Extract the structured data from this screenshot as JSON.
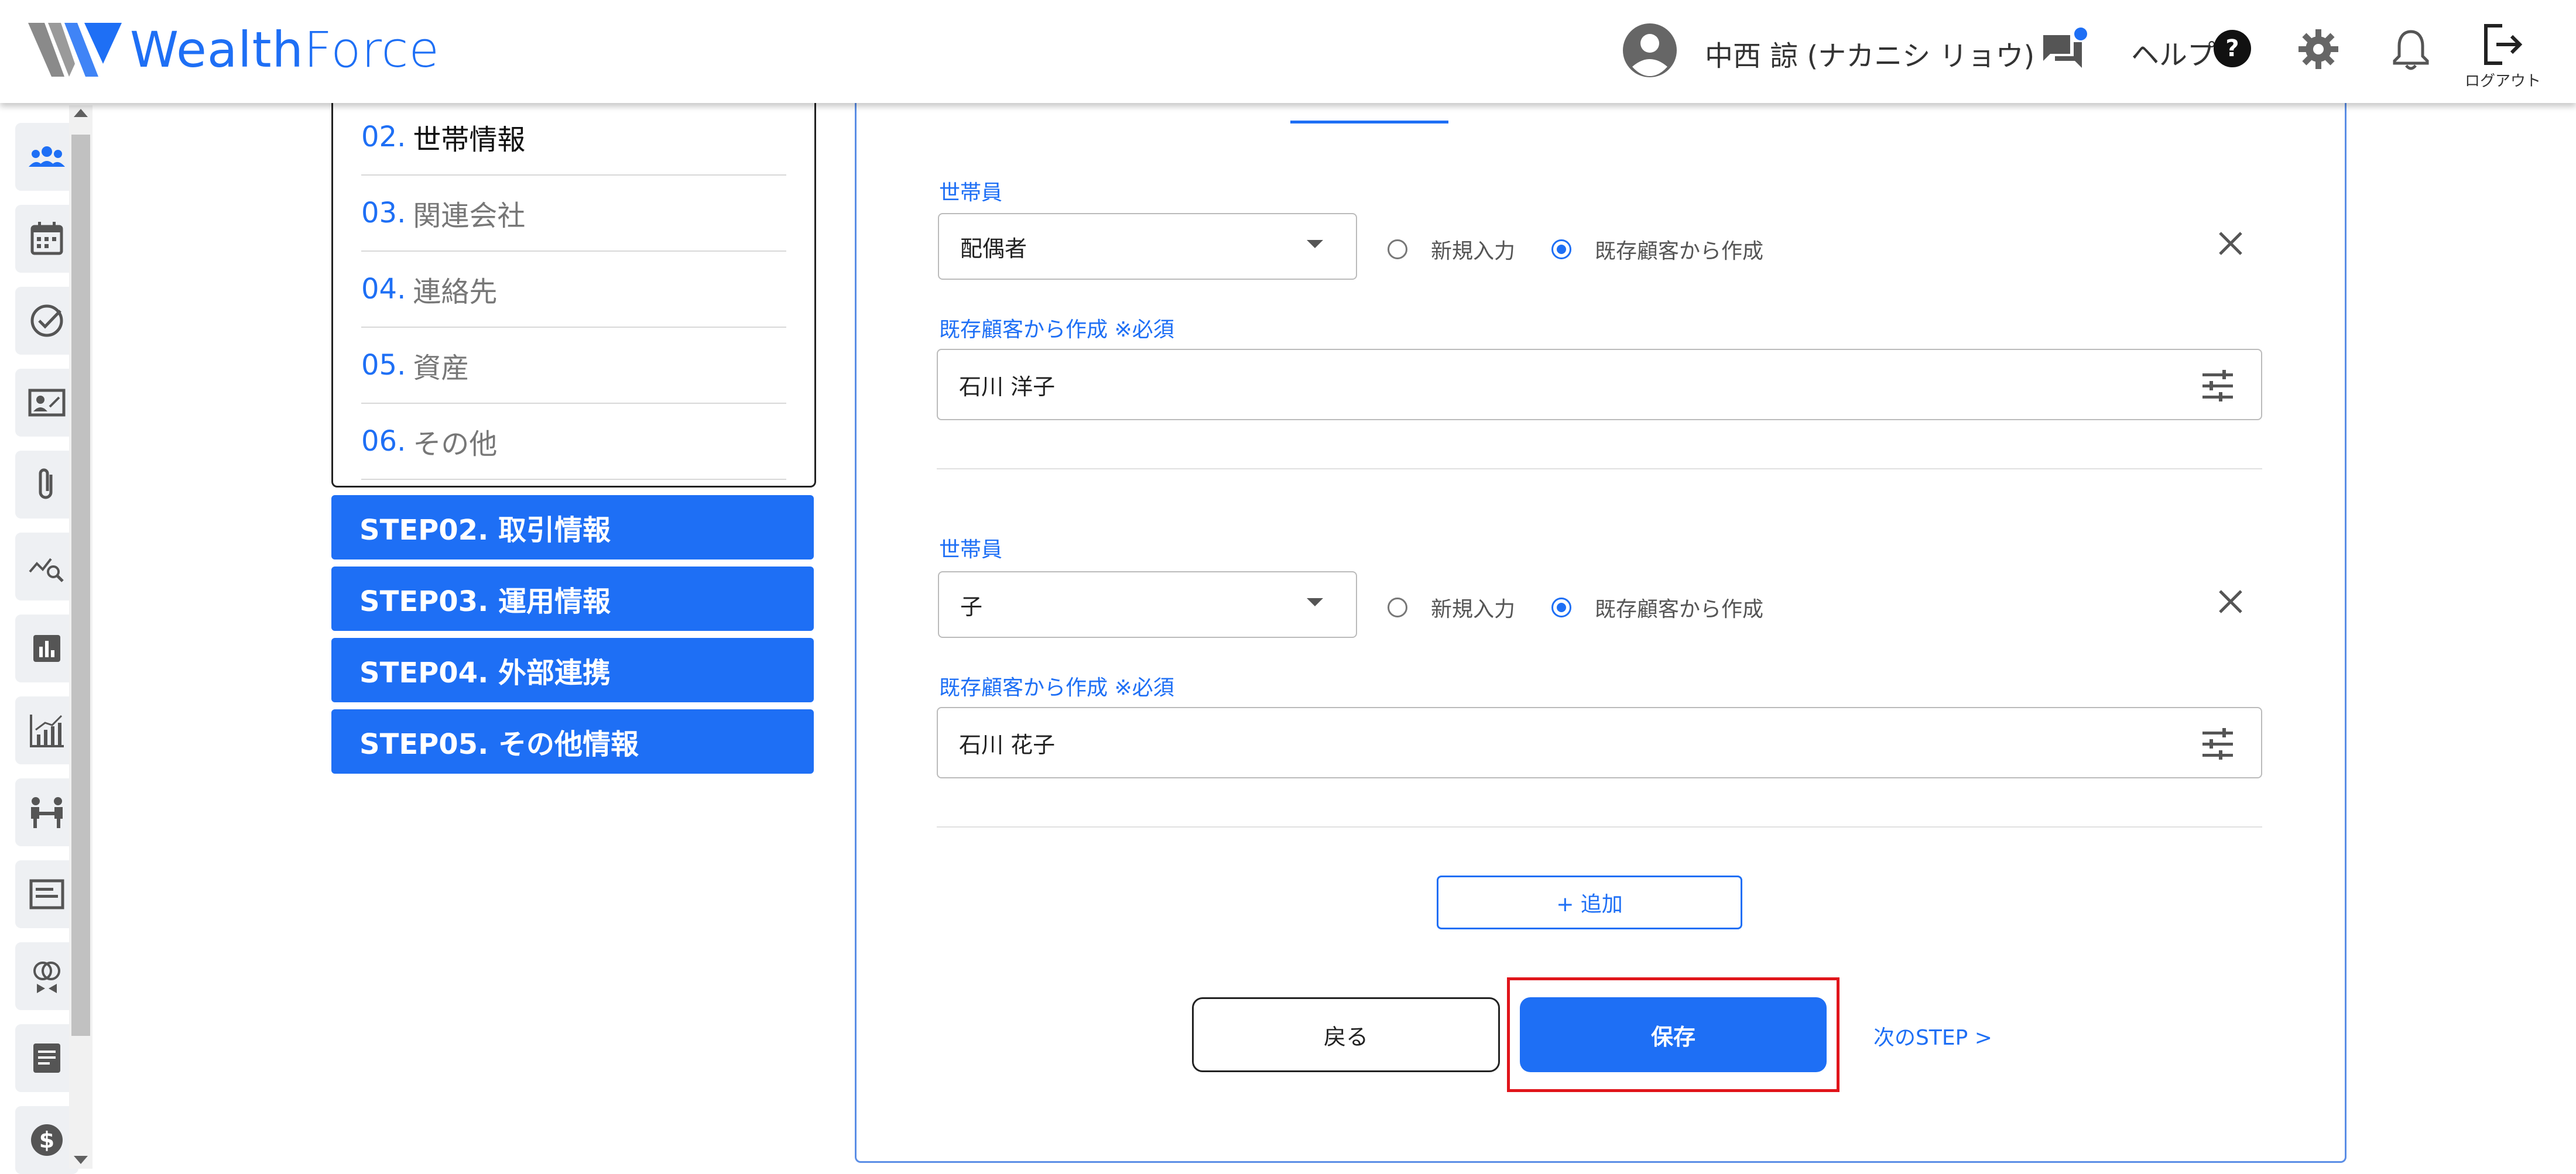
{
  "header": {
    "logo_text_bold": "Wealth",
    "logo_text_light": "Force",
    "user_name": "中西 諒 (ナカニシ リョウ)",
    "help_label": "ヘルプ",
    "logout_label": "ログアウト"
  },
  "rail": {
    "items": [
      "group-icon",
      "calendar-icon",
      "check-circle-icon",
      "contact-card-icon",
      "attachment-icon",
      "trend-search-icon",
      "bar-chart-icon",
      "growth-chart-icon",
      "meeting-icon",
      "message-card-icon",
      "compare-icon",
      "notes-icon",
      "dollar-icon"
    ]
  },
  "substeps": [
    {
      "num": "02.",
      "label": "世帯情報",
      "active": true
    },
    {
      "num": "03.",
      "label": "関連会社"
    },
    {
      "num": "04.",
      "label": "連絡先"
    },
    {
      "num": "05.",
      "label": "資産"
    },
    {
      "num": "06.",
      "label": "その他"
    }
  ],
  "steps": [
    "STEP02. 取引情報",
    "STEP03. 運用情報",
    "STEP04. 外部連携",
    "STEP05. その他情報"
  ],
  "members": [
    {
      "label": "世帯員",
      "relation": "配偶者",
      "radio_new": "新規入力",
      "radio_existing": "既存顧客から作成",
      "existing_label": "既存顧客から作成 ※必須",
      "existing_value": "石川 洋子"
    },
    {
      "label": "世帯員",
      "relation": "子",
      "radio_new": "新規入力",
      "radio_existing": "既存顧客から作成",
      "existing_label": "既存顧客から作成 ※必須",
      "existing_value": "石川 花子"
    }
  ],
  "actions": {
    "add_label": "+ 追加",
    "back_label": "戻る",
    "save_label": "保存",
    "next_label": "次のSTEP >"
  },
  "colors": {
    "brand": "#1e6ff5",
    "highlight": "#e0151b"
  }
}
